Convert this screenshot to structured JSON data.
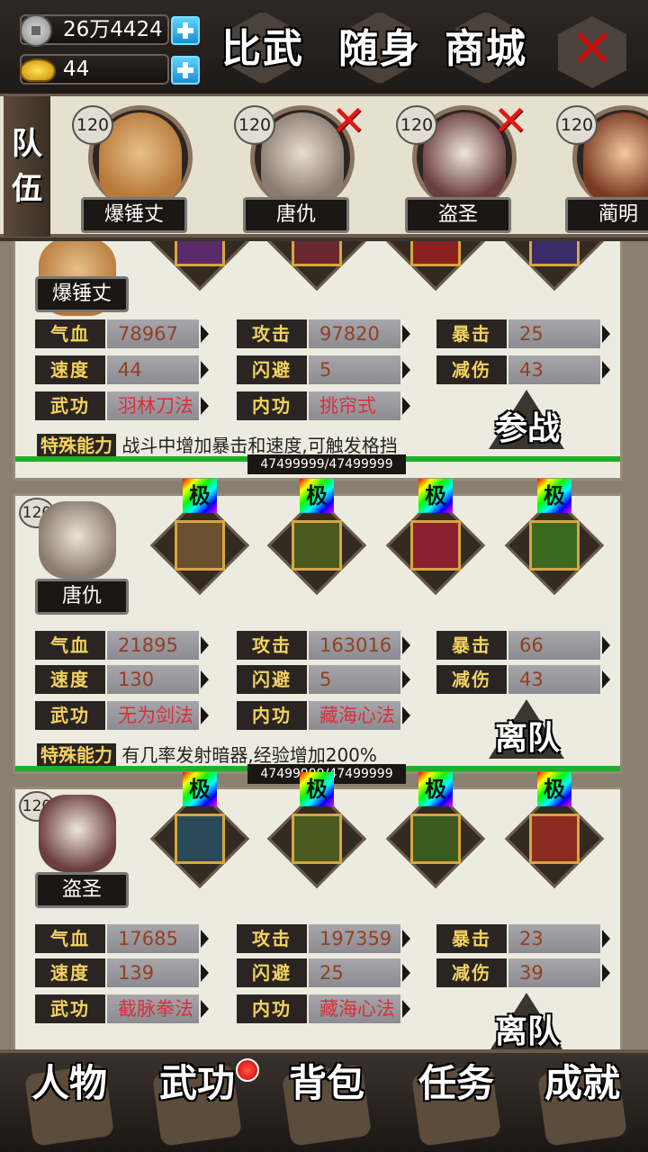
{
  "resources": {
    "silver": "26万4424",
    "gold": "44"
  },
  "top_menu": [
    "比武",
    "随身",
    "商城"
  ],
  "team_label": "队伍",
  "team": [
    {
      "level": "120",
      "name": "爆锤丈",
      "removable": false
    },
    {
      "level": "120",
      "name": "唐仇",
      "removable": true
    },
    {
      "level": "120",
      "name": "盗圣",
      "removable": true
    },
    {
      "level": "120",
      "name": "蔺明",
      "removable": false
    }
  ],
  "remove_mark": "✕",
  "stat_labels": {
    "hp": "气血",
    "atk": "攻击",
    "crit": "暴击",
    "speed": "速度",
    "dodge": "闪避",
    "reduce": "减伤",
    "skill": "武功",
    "inner": "内功",
    "special": "特殊能力"
  },
  "equip_tag": "极",
  "cards": [
    {
      "name": "爆锤丈",
      "hp": "78967",
      "atk": "97820",
      "crit": "25",
      "speed": "44",
      "dodge": "5",
      "reduce": "43",
      "skill": "羽林刀法",
      "inner": "挑帘式",
      "special": "战斗中增加暴击和速度,可触发格挡",
      "action": "参战",
      "exp": "47499999/47499999"
    },
    {
      "name": "唐仇",
      "level": "120",
      "hp": "21895",
      "atk": "163016",
      "crit": "66",
      "speed": "130",
      "dodge": "5",
      "reduce": "43",
      "skill": "无为剑法",
      "inner": "藏海心法",
      "special": "有几率发射暗器,经验增加200%",
      "action": "离队",
      "exp": "47499999/47499999"
    },
    {
      "name": "盗圣",
      "level": "120",
      "hp": "17685",
      "atk": "197359",
      "crit": "23",
      "speed": "139",
      "dodge": "25",
      "reduce": "39",
      "skill": "截脉拳法",
      "inner": "藏海心法",
      "action": "离队"
    }
  ],
  "bottom_nav": [
    "人物",
    "武功",
    "背包",
    "任务",
    "成就"
  ],
  "colors": {
    "stat_key": "#f3d260",
    "stat_value": "#934020",
    "skill_value": "#d8303a",
    "hp_bar": "#1db02a",
    "close": "#c21010"
  }
}
